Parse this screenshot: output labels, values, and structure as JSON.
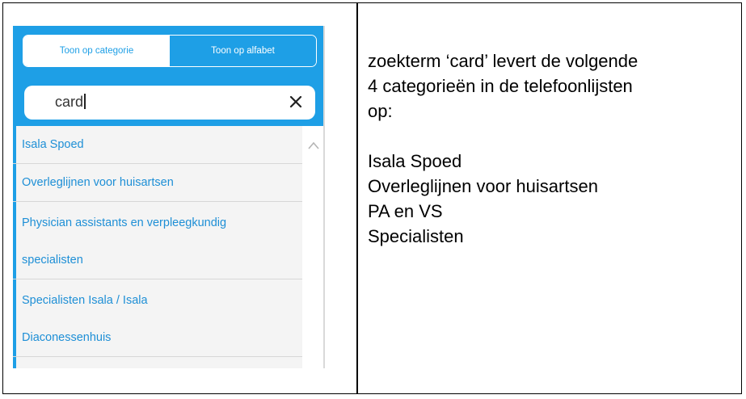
{
  "tabs": {
    "category_label": "Toon op categorie",
    "alphabet_label": "Toon op alfabet"
  },
  "search": {
    "value": "card",
    "clear_icon": "close-icon"
  },
  "results": [
    {
      "lines": [
        "Isala Spoed"
      ]
    },
    {
      "lines": [
        "Overleglijnen voor huisartsen"
      ]
    },
    {
      "lines": [
        "Physician assistants en verpleegkundig",
        "specialisten"
      ]
    },
    {
      "lines": [
        "Specialisten Isala / Isala",
        "Diaconessenhuis"
      ]
    }
  ],
  "description": {
    "intro_lines": [
      "zoekterm ‘card’ levert de volgende",
      "4 categorieën in de telefoonlijsten",
      "op:"
    ],
    "category_lines": [
      "Isala Spoed",
      "Overleglijnen voor huisartsen",
      "PA en VS",
      "Specialisten"
    ]
  },
  "colors": {
    "accent": "#1e9fe6",
    "link": "#1e8fd6",
    "list_background": "#f4f4f4"
  }
}
